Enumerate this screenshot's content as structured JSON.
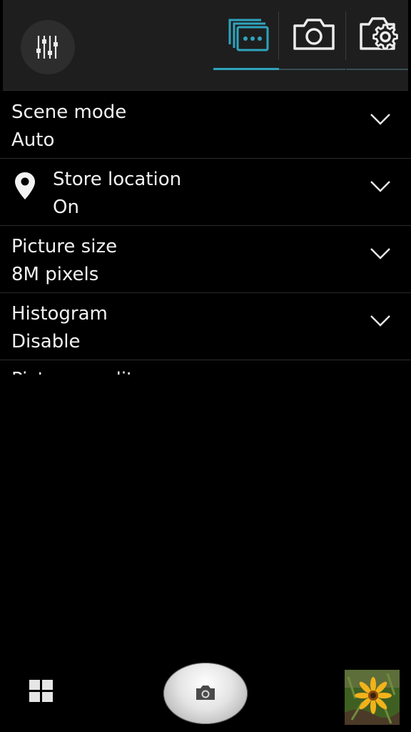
{
  "top_bar": {
    "tabs": [
      {
        "name": "more-settings",
        "icon": "dots-frames-icon",
        "active": true
      },
      {
        "name": "camera-settings",
        "icon": "camera-icon",
        "active": false
      },
      {
        "name": "general-settings",
        "icon": "gear-camera-icon",
        "active": false
      }
    ],
    "accent_color": "#2fa4bd",
    "background_color": "#1e1e1e"
  },
  "settings": [
    {
      "title": "Scene mode",
      "value": "Auto",
      "icon": null
    },
    {
      "title": "Store location",
      "value": "On",
      "icon": "location-pin-icon"
    },
    {
      "title": "Picture size",
      "value": "8M pixels",
      "icon": null
    },
    {
      "title": "Histogram",
      "value": "Disable",
      "icon": null
    },
    {
      "title": "Picture quality",
      "value": "",
      "icon": null
    }
  ],
  "bottom_bar": {
    "left_icon": "grid-icon",
    "shutter_icon": "camera-icon",
    "thumbnail": "flower-photo-thumbnail"
  }
}
